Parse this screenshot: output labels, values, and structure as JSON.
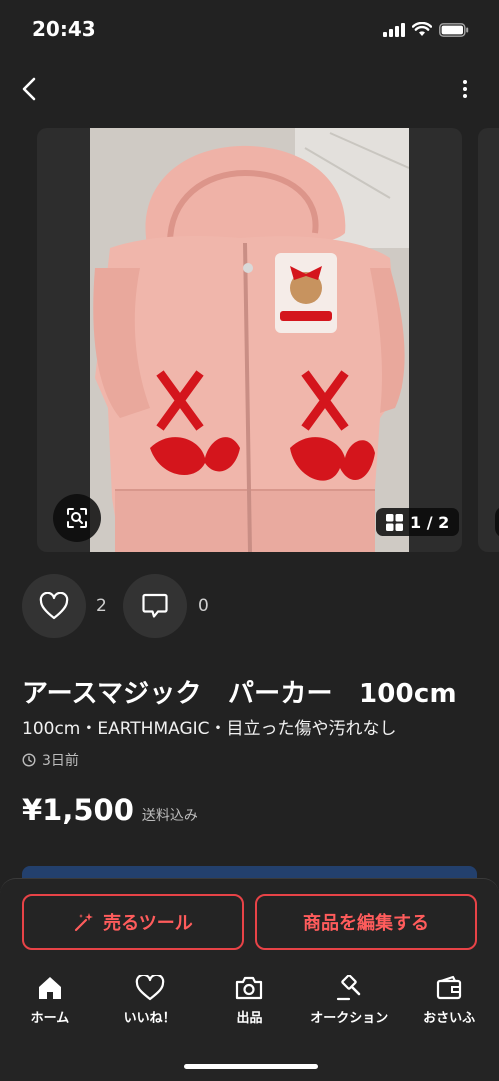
{
  "status_bar": {
    "time": "20:43"
  },
  "carousel": {
    "counter": "1 / 2"
  },
  "actions": {
    "like_count": "2",
    "comment_count": "0"
  },
  "item": {
    "title": "アースマジック　パーカー　100cm",
    "subtitle": "100cm・EARTHMAGIC・目立った傷や汚れなし",
    "posted": "3日前",
    "price": "¥1,500",
    "shipping": "送料込み"
  },
  "buttons": {
    "sell_tool": "売るツール",
    "edit_item": "商品を編集する"
  },
  "tabs": [
    {
      "label": "ホーム",
      "icon": "home-icon"
    },
    {
      "label": "いいね！",
      "icon": "heart-icon"
    },
    {
      "label": "出品",
      "icon": "camera-icon"
    },
    {
      "label": "オークション",
      "icon": "gavel-icon"
    },
    {
      "label": "おさいふ",
      "icon": "wallet-icon"
    }
  ],
  "colors": {
    "accent": "#e84347",
    "background": "#222222",
    "photo_hoodie": "#efb3a8",
    "ribbon": "#d4151c"
  }
}
